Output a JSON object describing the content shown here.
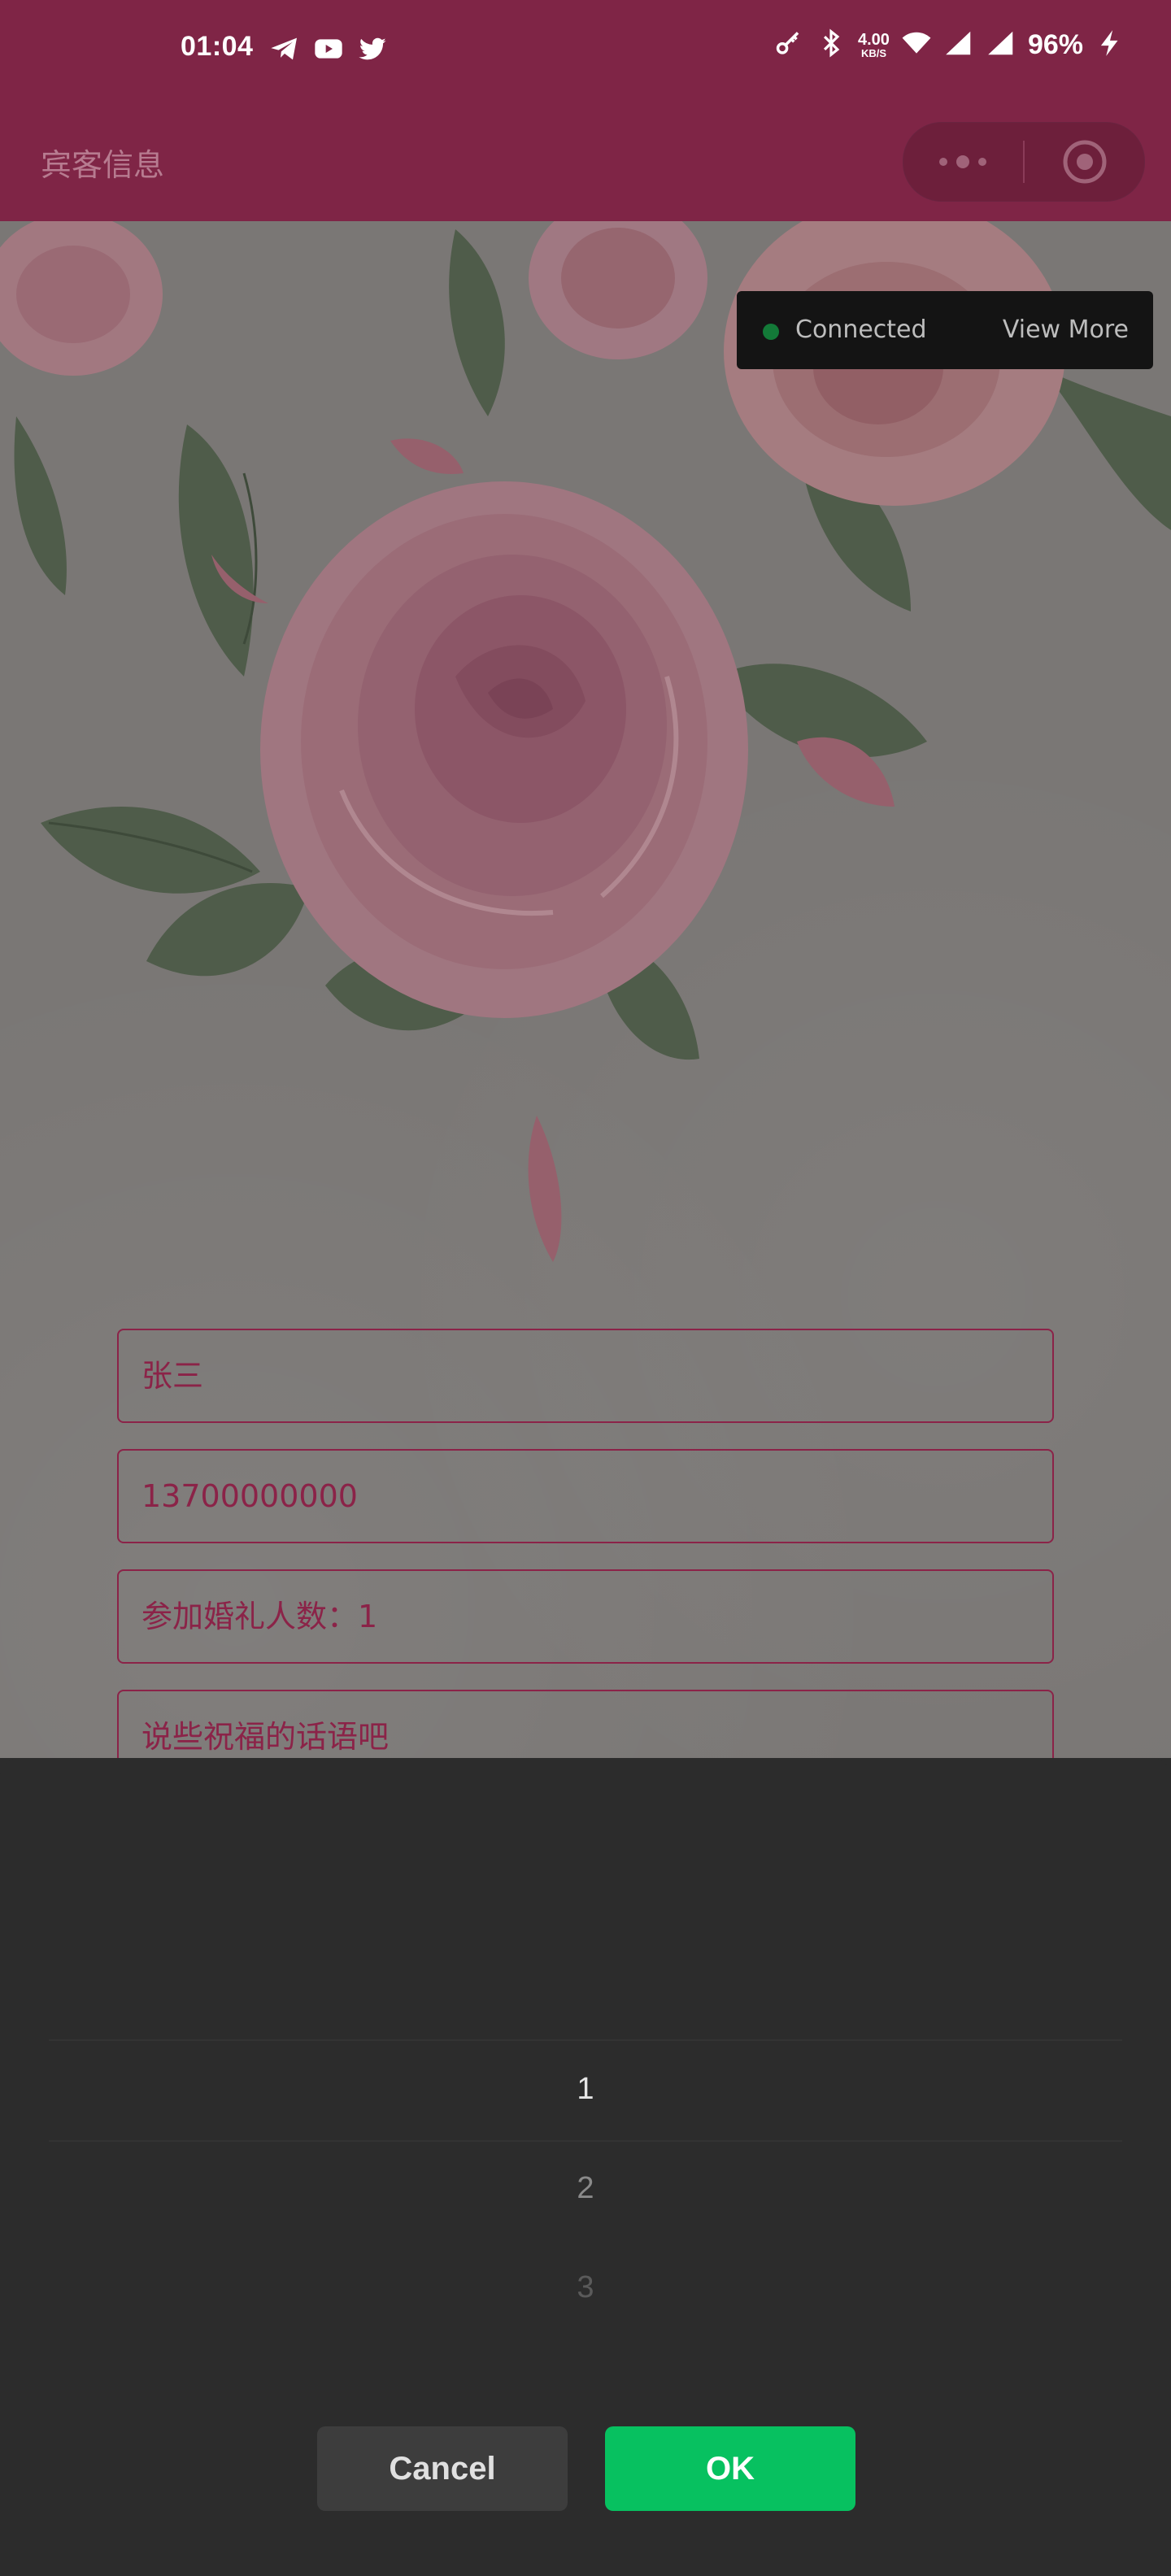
{
  "status_bar": {
    "time": "01:04",
    "net_speed_value": "4.00",
    "net_speed_unit": "KB/S",
    "battery": "96%"
  },
  "nav": {
    "title": "宾客信息"
  },
  "toast": {
    "status": "Connected",
    "action": "View More"
  },
  "form": {
    "name": "张三",
    "phone": "13700000000",
    "guests": "参加婚礼人数：1",
    "message_placeholder": "说些祝福的话语吧"
  },
  "picker": {
    "options": [
      "1",
      "2",
      "3"
    ],
    "selected": "1",
    "cancel_label": "Cancel",
    "ok_label": "OK"
  },
  "colors": {
    "brand": "#7f2546",
    "ok_green": "#07c160",
    "field_border": "#8b2348"
  }
}
